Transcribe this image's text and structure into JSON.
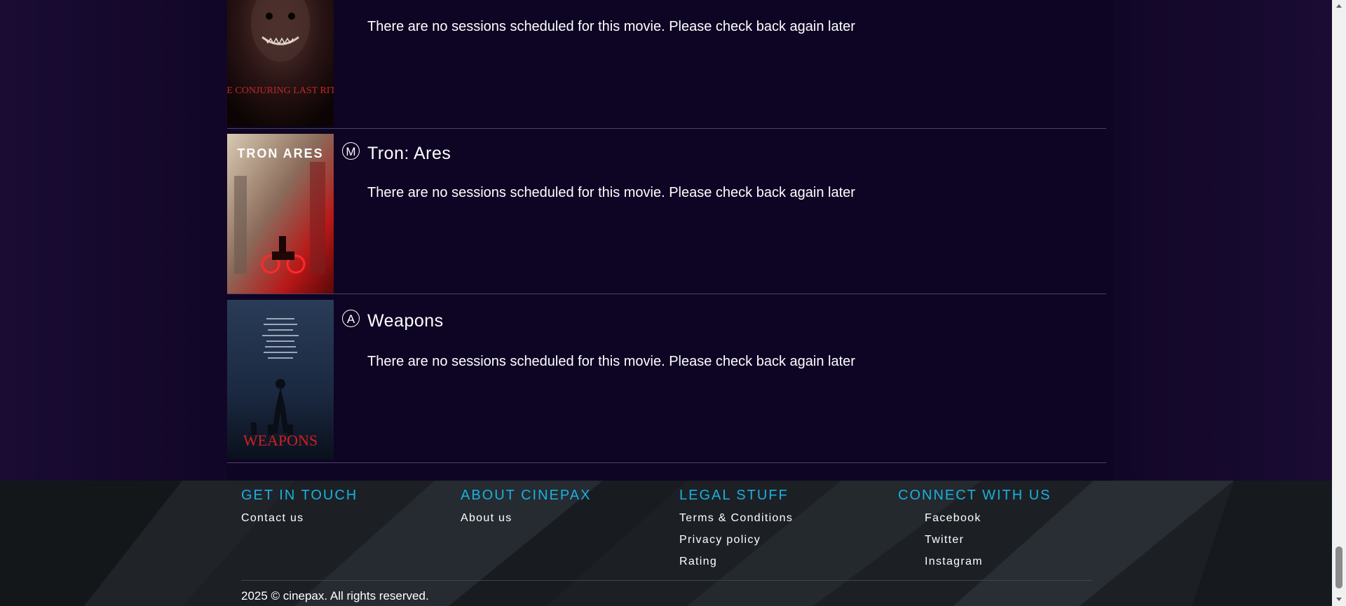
{
  "movies": [
    {
      "title": "",
      "rating": "",
      "message": "There are no sessions scheduled for this movie. Please check back again later",
      "poster_text": "THE CONJURING LAST RITES",
      "poster_colors": [
        "#3a1010",
        "#120606"
      ]
    },
    {
      "title": "Tron: Ares",
      "rating": "M",
      "message": "There are no sessions scheduled for this movie. Please check back again later",
      "poster_text": "TRON ARES",
      "poster_colors": [
        "#c8b8a0",
        "#c01818"
      ]
    },
    {
      "title": "Weapons",
      "rating": "A",
      "message": "There are no sessions scheduled for this movie. Please check back again later",
      "poster_text": "WEAPONS",
      "poster_colors": [
        "#1e2c40",
        "#0c1420"
      ]
    }
  ],
  "footer": {
    "columns": [
      {
        "heading": "GET IN TOUCH",
        "links": [
          "Contact us"
        ]
      },
      {
        "heading": "ABOUT CINEPAX",
        "links": [
          "About us"
        ]
      },
      {
        "heading": "LEGAL STUFF",
        "links": [
          "Terms & Conditions",
          "Privacy policy",
          "Rating"
        ]
      },
      {
        "heading": "CONNECT WITH US",
        "links": [
          "Facebook",
          "Twitter",
          "Instagram"
        ]
      }
    ],
    "copyright": "2025 © cinepax. All rights reserved."
  },
  "colors": {
    "accent": "#1ab0e0",
    "background": "#0e0424",
    "footer": "#1c2024"
  }
}
